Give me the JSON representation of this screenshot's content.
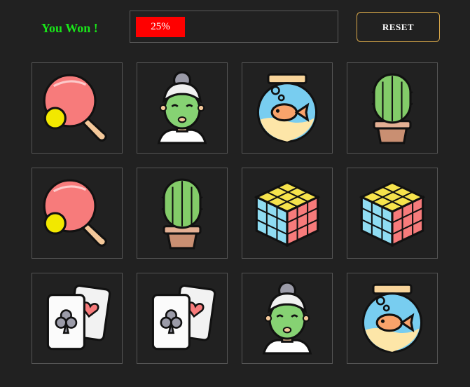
{
  "status": {
    "message": "You Won !",
    "color": "#19e619"
  },
  "progress": {
    "label": "25%",
    "value": 0.25
  },
  "controls": {
    "reset_label": "RESET"
  },
  "board": {
    "cards": [
      {
        "icon": "ping-pong-paddle-icon",
        "flipped": true
      },
      {
        "icon": "face-mask-woman-icon",
        "flipped": true
      },
      {
        "icon": "fishbowl-icon",
        "flipped": true
      },
      {
        "icon": "cactus-icon",
        "flipped": true
      },
      {
        "icon": "ping-pong-paddle-icon",
        "flipped": true
      },
      {
        "icon": "cactus-icon",
        "flipped": true
      },
      {
        "icon": "rubiks-cube-icon",
        "flipped": true
      },
      {
        "icon": "rubiks-cube-icon",
        "flipped": true
      },
      {
        "icon": "playing-cards-icon",
        "flipped": true
      },
      {
        "icon": "playing-cards-icon",
        "flipped": true
      },
      {
        "icon": "face-mask-woman-icon",
        "flipped": true
      },
      {
        "icon": "fishbowl-icon",
        "flipped": true
      }
    ]
  }
}
